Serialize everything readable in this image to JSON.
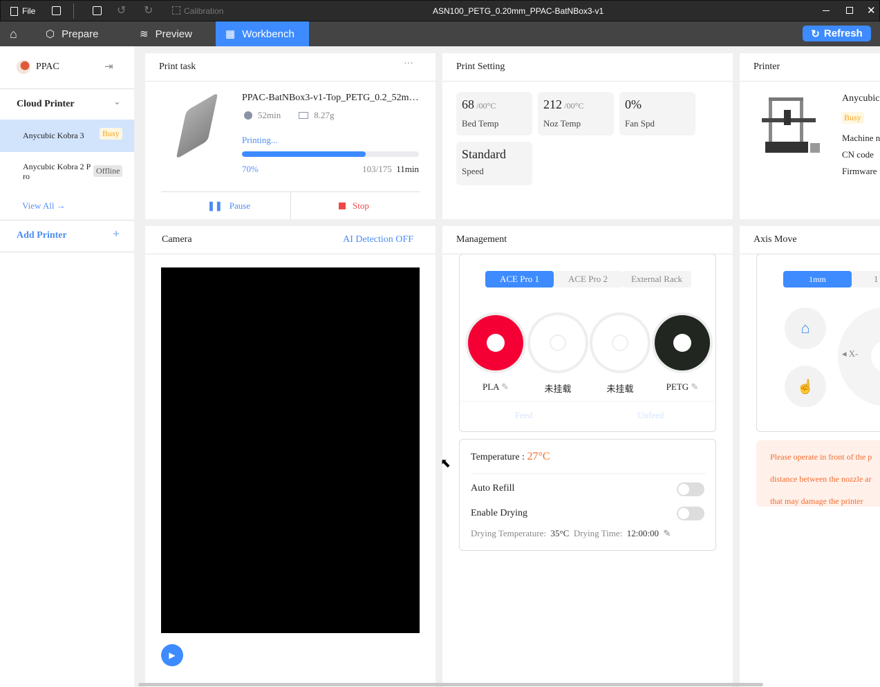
{
  "titlebar": {
    "file": "File",
    "calibration": "Calibration",
    "title": "ASN100_PETG_0.20mm_PPAC-BatNBox3-v1"
  },
  "tabs": {
    "prepare": "Prepare",
    "preview": "Preview",
    "workbench": "Workbench",
    "refresh": "Refresh"
  },
  "sidebar": {
    "user": "PPAC",
    "cloud_printer": "Cloud Printer",
    "printers": [
      {
        "name": "Anycubic Kobra 3",
        "status": "Busy"
      },
      {
        "name_line1": "Anycubic Kobra 2 P",
        "name_line2": "ro",
        "status": "Offline"
      }
    ],
    "view_all": "View All",
    "add_printer": "Add Printer"
  },
  "print_task": {
    "title": "Print task",
    "more": "···",
    "file": "PPAC-BatNBox3-v1-Top_PETG_0.2_52m…",
    "time": "52min",
    "weight": "8.27g",
    "state": "Printing...",
    "progress_pct": 70,
    "progress_label": "70%",
    "layers": "103/175",
    "remaining": "11min",
    "pause": "Pause",
    "stop": "Stop"
  },
  "print_setting": {
    "title": "Print Setting",
    "bed": {
      "value": "68",
      "target": "/00°C",
      "label": "Bed Temp"
    },
    "nozzle": {
      "value": "212",
      "target": "/00°C",
      "label": "Noz Temp"
    },
    "fan": {
      "value": "0%",
      "label": "Fan Spd"
    },
    "speed": {
      "value": "Standard",
      "label": "Speed"
    }
  },
  "printer": {
    "title": "Printer",
    "name": "Anycubic",
    "status": "Busy",
    "machine": "Machine n",
    "cn_code": "CN code",
    "firmware": "Firmware"
  },
  "camera": {
    "title": "Camera",
    "ai_detection": "AI Detection OFF"
  },
  "management": {
    "title": "Management",
    "tabs": [
      "ACE Pro 1",
      "ACE Pro 2",
      "External Rack"
    ],
    "slots": [
      {
        "label": "PLA",
        "color": "#f50035"
      },
      {
        "label": "未挂载",
        "color": ""
      },
      {
        "label": "未挂载",
        "color": ""
      },
      {
        "label": "PETG",
        "color": "#212621"
      }
    ],
    "feed": "Feed",
    "unfeed": "Unfeed",
    "temperature_label": "Temperature : ",
    "temperature_value": "27°C",
    "auto_refill": "Auto Refill",
    "enable_drying": "Enable Drying",
    "drying_temp_label": "Drying Temperature:",
    "drying_temp": "35°C",
    "drying_time_label": "Drying Time:",
    "drying_time": "12:00:00"
  },
  "axis": {
    "title": "Axis Move",
    "steps": [
      "1mm",
      "1"
    ],
    "x_minus": "X-",
    "warning": [
      "Please operate in front of the p",
      "distance between the nozzle ar",
      "that may damage the printer"
    ]
  }
}
